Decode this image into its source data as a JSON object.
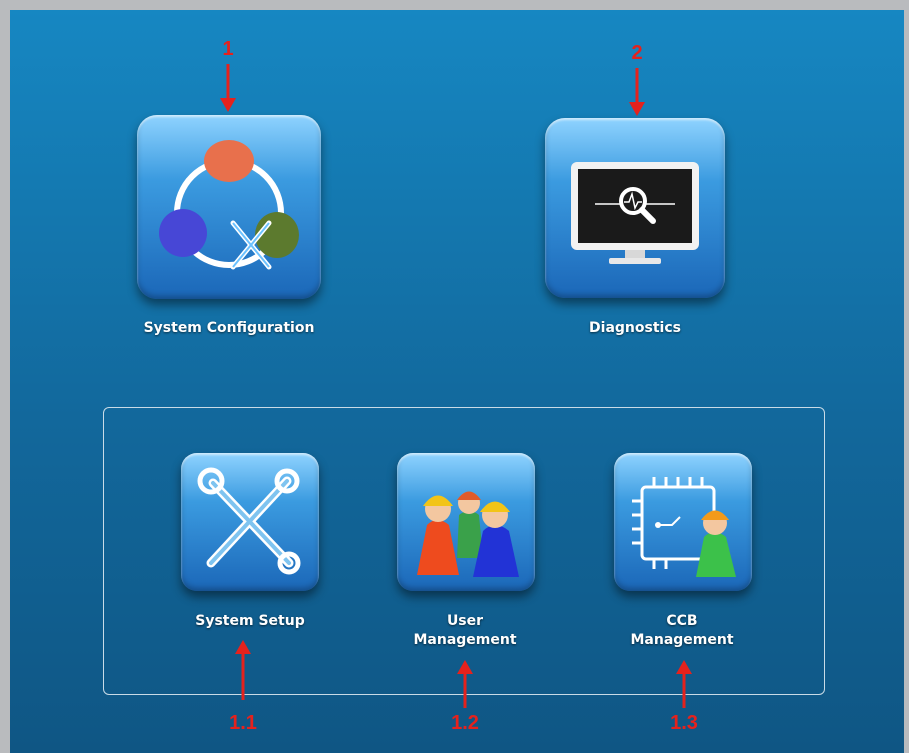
{
  "tiles": {
    "system_configuration": "System Configuration",
    "diagnostics": "Diagnostics",
    "system_setup": "System Setup",
    "user_management_line1": "User",
    "user_management_line2": "Management",
    "ccb_management_line1": "CCB",
    "ccb_management_line2": "Management"
  },
  "annotations": {
    "marker_1": "1",
    "marker_2": "2",
    "marker_1_1": "1.1",
    "marker_1_2": "1.2",
    "marker_1_3": "1.3",
    "color": "#e5221d"
  },
  "icons": {
    "system_configuration": "config-cycle-icon",
    "diagnostics": "monitor-magnifier-icon",
    "system_setup": "crossed-wrenches-icon",
    "user_management": "workers-group-icon",
    "ccb_management": "circuit-board-worker-icon"
  },
  "colors": {
    "background_top": "#1687c2",
    "background_bottom": "#0f5684",
    "tile_light": "#8fd3ff",
    "tile_dark": "#1b67b8"
  }
}
